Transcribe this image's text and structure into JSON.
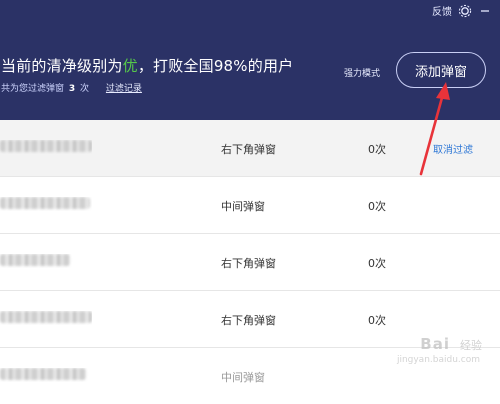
{
  "topbar": {
    "feedback_label": "反馈"
  },
  "header": {
    "status_prefix": "当前的清净级别为",
    "status_grade": "优",
    "status_suffix": "，打败全国98%的用户",
    "sub_prefix": "共为您过滤弹窗",
    "sub_count": "3",
    "sub_unit": "次",
    "history_link": "过滤记录",
    "mode_label": "强力模式",
    "add_button_label": "添加弹窗"
  },
  "table": {
    "rows": [
      {
        "type": "右下角弹窗",
        "count": "0次",
        "action": "取消过滤"
      },
      {
        "type": "中间弹窗",
        "count": "0次"
      },
      {
        "type": "右下角弹窗",
        "count": "0次"
      },
      {
        "type": "右下角弹窗",
        "count": "0次"
      },
      {
        "type": "中间弹窗"
      }
    ]
  },
  "watermark": {
    "logo": "Bai",
    "text": "经验",
    "url": "jingyan.baidu.com"
  },
  "colors": {
    "header_bg": "#2b3266",
    "grade_green": "#56c84a",
    "link_blue": "#2f78d6",
    "arrow_red": "#e8333a"
  }
}
